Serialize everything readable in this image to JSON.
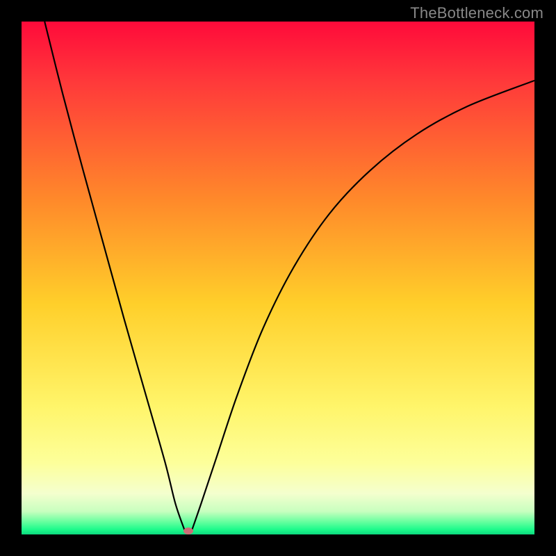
{
  "watermark": "TheBottleneck.com",
  "chart_data": {
    "type": "line",
    "title": "",
    "xlabel": "",
    "ylabel": "",
    "xlim": [
      0,
      100
    ],
    "ylim": [
      0,
      100
    ],
    "gradient_stops": [
      {
        "offset": 0.0,
        "color": "#ff0a3a"
      },
      {
        "offset": 0.12,
        "color": "#ff3a3a"
      },
      {
        "offset": 0.35,
        "color": "#ff8a2a"
      },
      {
        "offset": 0.55,
        "color": "#ffcf2a"
      },
      {
        "offset": 0.75,
        "color": "#fff56a"
      },
      {
        "offset": 0.86,
        "color": "#fdff9a"
      },
      {
        "offset": 0.92,
        "color": "#f4ffce"
      },
      {
        "offset": 0.955,
        "color": "#c8ffbf"
      },
      {
        "offset": 0.975,
        "color": "#68ff9f"
      },
      {
        "offset": 0.99,
        "color": "#1efb8c"
      },
      {
        "offset": 1.0,
        "color": "#0cd97e"
      }
    ],
    "curve_left": {
      "x": [
        4.5,
        8,
        12,
        16,
        20,
        24,
        28,
        30,
        31.8
      ],
      "y": [
        100,
        86,
        71,
        56.5,
        42,
        28,
        14,
        6,
        0.8
      ]
    },
    "curve_right": {
      "x": [
        33.2,
        35,
        38,
        42,
        47,
        53,
        60,
        68,
        77,
        87,
        100
      ],
      "y": [
        0.8,
        6,
        15,
        27,
        40,
        52,
        62.5,
        71,
        78,
        83.5,
        88.5
      ]
    },
    "marker": {
      "x": 32.5,
      "y": 0.7,
      "color": "#cc6d76"
    }
  }
}
